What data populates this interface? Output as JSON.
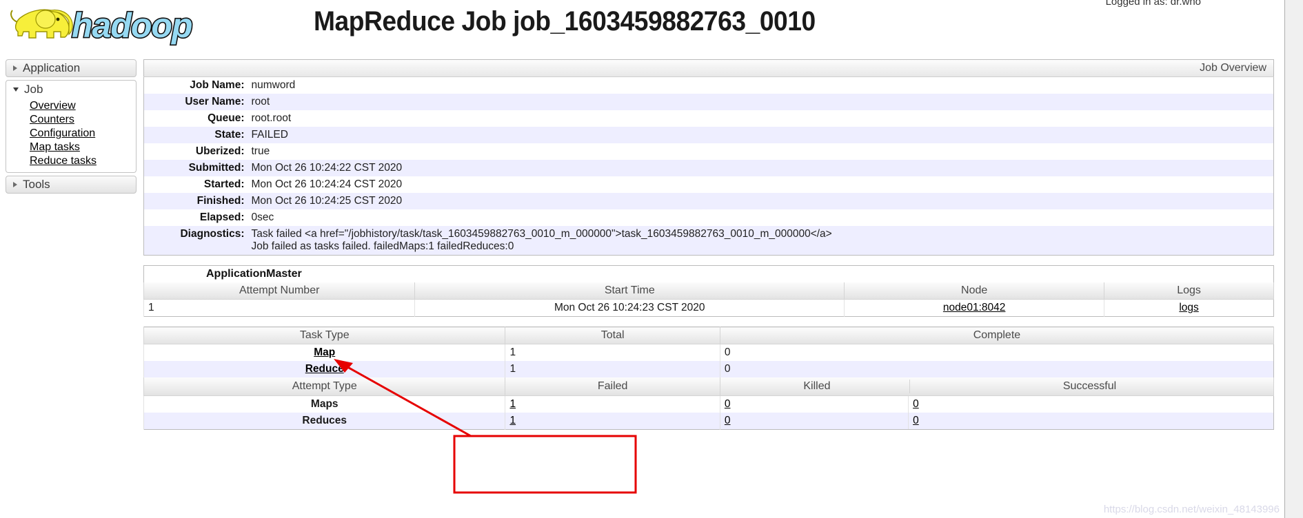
{
  "header": {
    "logo_alt": "hadoop",
    "title": "MapReduce Job job_1603459882763_0010",
    "logged_in": "Logged in as: dr.who"
  },
  "sidebar": {
    "sections": [
      {
        "label": "Application",
        "expanded": false,
        "items": []
      },
      {
        "label": "Job",
        "expanded": true,
        "items": [
          {
            "label": "Overview"
          },
          {
            "label": "Counters"
          },
          {
            "label": "Configuration"
          },
          {
            "label": "Map tasks"
          },
          {
            "label": "Reduce tasks"
          }
        ]
      },
      {
        "label": "Tools",
        "expanded": false,
        "items": []
      }
    ]
  },
  "job_overview": {
    "caption": "Job Overview",
    "rows": [
      {
        "key": "Job Name:",
        "value": "numword"
      },
      {
        "key": "User Name:",
        "value": "root"
      },
      {
        "key": "Queue:",
        "value": "root.root"
      },
      {
        "key": "State:",
        "value": "FAILED"
      },
      {
        "key": "Uberized:",
        "value": "true"
      },
      {
        "key": "Submitted:",
        "value": "Mon Oct 26 10:24:22 CST 2020"
      },
      {
        "key": "Started:",
        "value": "Mon Oct 26 10:24:24 CST 2020"
      },
      {
        "key": "Finished:",
        "value": "Mon Oct 26 10:24:25 CST 2020"
      },
      {
        "key": "Elapsed:",
        "value": "0sec"
      }
    ],
    "diagnostics_key": "Diagnostics:",
    "diagnostics_line1": "Task failed <a href=\"/jobhistory/task/task_1603459882763_0010_m_000000\">task_1603459882763_0010_m_000000</a>",
    "diagnostics_line2": "Job failed as tasks failed. failedMaps:1 failedReduces:0"
  },
  "application_master": {
    "title": "ApplicationMaster",
    "columns": [
      "Attempt Number",
      "Start Time",
      "Node",
      "Logs"
    ],
    "rows": [
      {
        "attempt": "1",
        "start_time": "Mon Oct 26 10:24:23 CST 2020",
        "node": "node01:8042",
        "logs": "logs"
      }
    ]
  },
  "task_summary": {
    "columns": [
      "Task Type",
      "Total",
      "Complete"
    ],
    "rows": [
      {
        "type": "Map",
        "total": "1",
        "complete": "0"
      },
      {
        "type": "Reduce",
        "total": "1",
        "complete": "0"
      }
    ]
  },
  "attempt_summary": {
    "columns": [
      "Attempt Type",
      "Failed",
      "Killed",
      "Successful"
    ],
    "rows": [
      {
        "type": "Maps",
        "failed": "1",
        "killed": "0",
        "successful": "0"
      },
      {
        "type": "Reduces",
        "failed": "1",
        "killed": "0",
        "successful": "0"
      }
    ]
  },
  "annotations": {
    "highlight_color": "#e60000",
    "watermark": "https://blog.csdn.net/weixin_48143996"
  }
}
